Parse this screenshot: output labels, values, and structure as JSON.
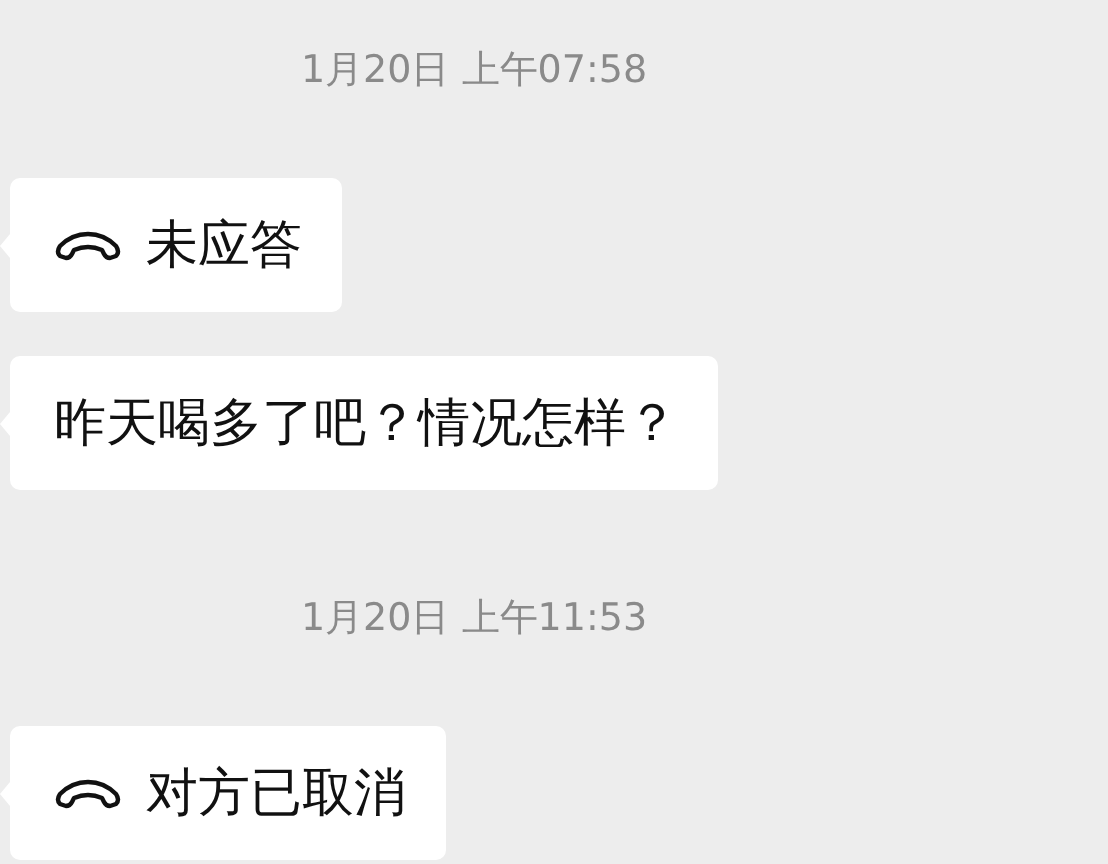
{
  "messages": [
    {
      "kind": "time",
      "text": "1月20日 上午07:58"
    },
    {
      "kind": "call",
      "text": "未应答"
    },
    {
      "kind": "text",
      "text": "昨天喝多了吧？情况怎样？"
    },
    {
      "kind": "time",
      "text": "1月20日 上午11:53"
    },
    {
      "kind": "call",
      "text": "对方已取消"
    }
  ]
}
